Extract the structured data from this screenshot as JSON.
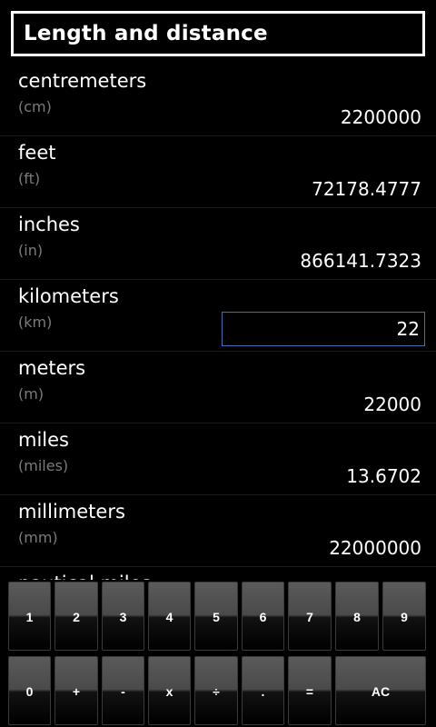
{
  "header": {
    "title": "Length and distance"
  },
  "units": [
    {
      "name": "centremeters",
      "abbr": "(cm)",
      "value": "2200000"
    },
    {
      "name": "feet",
      "abbr": "(ft)",
      "value": "72178.4777"
    },
    {
      "name": "inches",
      "abbr": "(in)",
      "value": "866141.7323"
    },
    {
      "name": "kilometers",
      "abbr": "(km)",
      "value": "22"
    },
    {
      "name": "meters",
      "abbr": "(m)",
      "value": "22000"
    },
    {
      "name": "miles",
      "abbr": "(miles)",
      "value": "13.6702"
    },
    {
      "name": "millimeters",
      "abbr": "(mm)",
      "value": "22000000"
    },
    {
      "name": "nautical miles",
      "abbr": "",
      "value": ""
    }
  ],
  "keypad": {
    "row1": [
      "1",
      "2",
      "3",
      "4",
      "5",
      "6",
      "7",
      "8",
      "9"
    ],
    "row2": [
      "0",
      "+",
      "-",
      "x",
      "÷",
      ".",
      "=",
      "AC"
    ]
  },
  "colors": {
    "background": "#000000",
    "input_border": "#3f6fae",
    "secondary_text": "#7b7b7b"
  }
}
